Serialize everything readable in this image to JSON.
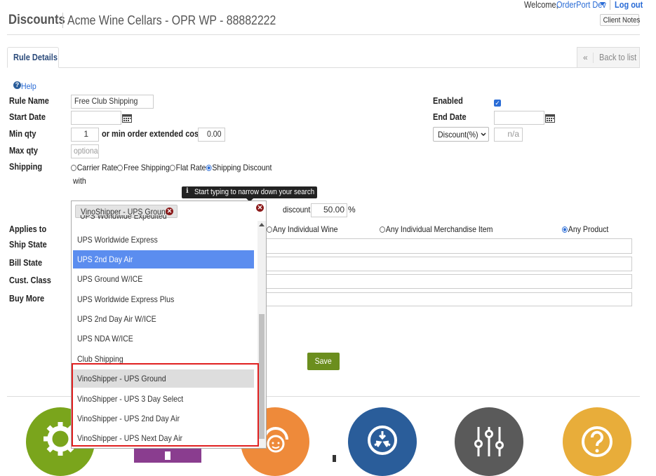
{
  "header": {
    "title": "Discounts",
    "subtitle": "Acme Wine Cellars - OPR WP - 88882222",
    "welcome": "Welcome,",
    "user": "OrderPort Dev",
    "logout": "Log out",
    "client_notes": "Client Notes"
  },
  "tabs": {
    "rule_details": "Rule Details",
    "back_arrow": "«",
    "back_to_list": "Back to list"
  },
  "help": "Help",
  "form": {
    "rule_name_label": "Rule Name",
    "rule_name_value": "Free Club Shipping",
    "enabled_label": "Enabled",
    "enabled": true,
    "start_date_label": "Start Date",
    "end_date_label": "End Date",
    "min_qty_label": "Min qty",
    "min_qty_value": "1",
    "min_cost_label": "or min order extended cost $",
    "min_cost_value": "0.00",
    "discount_type": "Discount(%)",
    "discount_type_value": "n/a",
    "max_qty_label": "Max qty",
    "max_qty_placeholder": "optiona",
    "shipping_label": "Shipping",
    "shipping_options": [
      "Carrier Rate",
      "Free Shipping",
      "Flat Rate",
      "Shipping Discount"
    ],
    "with_label": "with",
    "tooltip": "Start typing to narrow down your search",
    "tooltip_icon": "info-icon",
    "selected_tag": "VinoShipper - UPS Ground",
    "discount_label": "discount",
    "discount_value": "50.00",
    "percent": "%",
    "applies_to_label": "Applies to",
    "applies_options": [
      "Any Individual Wine",
      "Any Individual Merchandise Item",
      "Any Product"
    ],
    "ship_state_label": "Ship State",
    "bill_state_label": "Bill State",
    "cust_class_label": "Cust. Class",
    "buy_more_label": "Buy More",
    "save": "Save"
  },
  "dropdown": {
    "partial_item": "UPS Worldwide Expedited",
    "items": [
      "UPS Worldwide Express",
      "UPS 2nd Day Air",
      "UPS Ground W/ICE",
      "UPS Worldwide Express Plus",
      "UPS 2nd Day Air W/ICE",
      "UPS NDA W/ICE",
      "Club Shipping",
      "VinoShipper - UPS Ground",
      "VinoShipper - UPS 3 Day Select",
      "VinoShipper - UPS 2nd Day Air",
      "VinoShipper - UPS Next Day Air"
    ],
    "highlighted_index": 1,
    "selected_index": 7,
    "highlight_color": "#5b8def",
    "annotation_color": "#e02020"
  },
  "dashboard_icons": [
    "gear-icon",
    "grid-icon",
    "support-icon",
    "sync-icon",
    "sliders-icon",
    "question-icon"
  ],
  "colors": {
    "accent_blue": "#2a6cd6",
    "save_green": "#6b8e1e",
    "orange": "#ee8a3a",
    "navy": "#2a5d9a",
    "gray": "#5a5a5a",
    "yellow": "#e8ad3a",
    "green": "#7aa51c",
    "purple": "#8a3d8f"
  }
}
